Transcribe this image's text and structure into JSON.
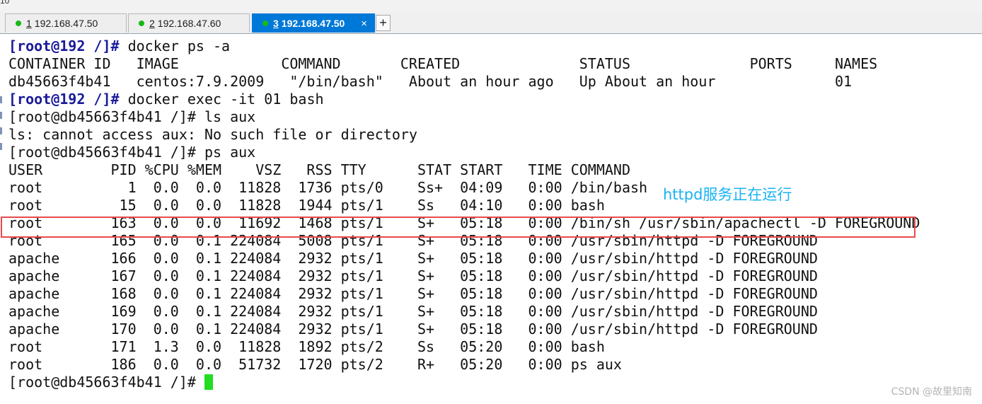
{
  "top_fragment": "10",
  "tabs": [
    {
      "num": "1",
      "host": "192.168.47.50",
      "active": false
    },
    {
      "num": "2",
      "host": "192.168.47.60",
      "active": false
    },
    {
      "num": "3",
      "host": "192.168.47.50",
      "active": true
    }
  ],
  "tab_close_glyph": "×",
  "new_tab_glyph": "+",
  "terminal": {
    "lines": [
      {
        "prompt": "[root@192 /]#",
        "text": " docker ps -a"
      },
      {
        "prompt": "",
        "text": "CONTAINER ID   IMAGE            COMMAND       CREATED              STATUS              PORTS     NAMES"
      },
      {
        "prompt": "",
        "text": "db45663f4b41   centos:7.9.2009   \"/bin/bash\"   About an hour ago   Up About an hour              01"
      },
      {
        "prompt": "[root@192 /]#",
        "text": " docker exec -it 01 bash"
      },
      {
        "prompt": "",
        "text": "[root@db45663f4b41 /]# ls aux"
      },
      {
        "prompt": "",
        "text": "ls: cannot access aux: No such file or directory"
      },
      {
        "prompt": "",
        "text": "[root@db45663f4b41 /]# ps aux"
      },
      {
        "prompt": "",
        "text": "USER        PID %CPU %MEM    VSZ   RSS TTY      STAT START   TIME COMMAND"
      },
      {
        "prompt": "",
        "text": "root          1  0.0  0.0  11828  1736 pts/0    Ss+  04:09   0:00 /bin/bash"
      },
      {
        "prompt": "",
        "text": "root         15  0.0  0.0  11828  1944 pts/1    Ss   04:10   0:00 bash"
      },
      {
        "prompt": "",
        "text": "root        163  0.0  0.0  11692  1468 pts/1    S+   05:18   0:00 /bin/sh /usr/sbin/apachectl -D FOREGROUND"
      },
      {
        "prompt": "",
        "text": "root        165  0.0  0.1 224084  5008 pts/1    S+   05:18   0:00 /usr/sbin/httpd -D FOREGROUND"
      },
      {
        "prompt": "",
        "text": "apache      166  0.0  0.1 224084  2932 pts/1    S+   05:18   0:00 /usr/sbin/httpd -D FOREGROUND"
      },
      {
        "prompt": "",
        "text": "apache      167  0.0  0.1 224084  2932 pts/1    S+   05:18   0:00 /usr/sbin/httpd -D FOREGROUND"
      },
      {
        "prompt": "",
        "text": "apache      168  0.0  0.1 224084  2932 pts/1    S+   05:18   0:00 /usr/sbin/httpd -D FOREGROUND"
      },
      {
        "prompt": "",
        "text": "apache      169  0.0  0.1 224084  2932 pts/1    S+   05:18   0:00 /usr/sbin/httpd -D FOREGROUND"
      },
      {
        "prompt": "",
        "text": "apache      170  0.0  0.1 224084  2932 pts/1    S+   05:18   0:00 /usr/sbin/httpd -D FOREGROUND"
      },
      {
        "prompt": "",
        "text": "root        171  1.3  0.0  11828  1892 pts/2    Ss   05:20   0:00 bash"
      },
      {
        "prompt": "",
        "text": "root        186  0.0  0.0  51732  1720 pts/2    R+   05:20   0:00 ps aux"
      },
      {
        "prompt": "",
        "text": "[root@db45663f4b41 /]# ",
        "cursor": true
      }
    ]
  },
  "annotation": {
    "text": "httpd服务正在运行",
    "color": "#19b3f2",
    "box_color": "#e84a4a"
  },
  "watermark": "CSDN @故里知南",
  "colors": {
    "active_tab": "#0078d7",
    "status_dot": "#18b918",
    "prompt": "#1a1a9a",
    "cursor": "#22dd22"
  }
}
